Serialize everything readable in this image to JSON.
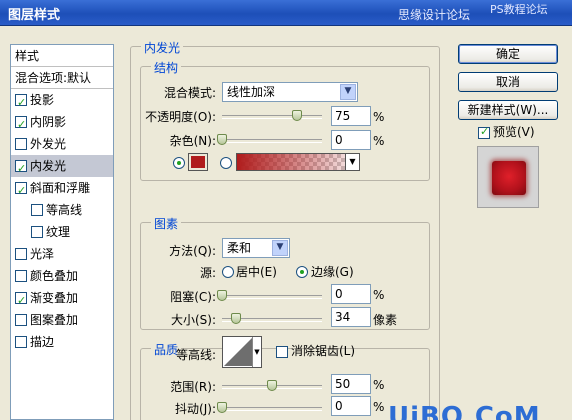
{
  "window": {
    "title": "图层样式",
    "watermark_top": "思缘设计论坛",
    "watermark_top_right": "PS教程论坛"
  },
  "style_list": {
    "header": "样式",
    "blend_options": "混合选项:默认",
    "items": [
      {
        "label": "投影",
        "checked": true,
        "indent": false,
        "selected": false
      },
      {
        "label": "内阴影",
        "checked": true,
        "indent": false,
        "selected": false
      },
      {
        "label": "外发光",
        "checked": false,
        "indent": false,
        "selected": false
      },
      {
        "label": "内发光",
        "checked": true,
        "indent": false,
        "selected": true
      },
      {
        "label": "斜面和浮雕",
        "checked": true,
        "indent": false,
        "selected": false
      },
      {
        "label": "等高线",
        "checked": false,
        "indent": true,
        "selected": false
      },
      {
        "label": "纹理",
        "checked": false,
        "indent": true,
        "selected": false
      },
      {
        "label": "光泽",
        "checked": false,
        "indent": false,
        "selected": false
      },
      {
        "label": "颜色叠加",
        "checked": false,
        "indent": false,
        "selected": false
      },
      {
        "label": "渐变叠加",
        "checked": true,
        "indent": false,
        "selected": false
      },
      {
        "label": "图案叠加",
        "checked": false,
        "indent": false,
        "selected": false
      },
      {
        "label": "描边",
        "checked": false,
        "indent": false,
        "selected": false
      }
    ]
  },
  "inner_glow": {
    "title": "内发光",
    "structure": {
      "title": "结构",
      "blend_mode_label": "混合模式:",
      "blend_mode_value": "线性加深",
      "opacity_label": "不透明度(O):",
      "opacity_value": "75",
      "opacity_fraction": 0.75,
      "noise_label": "杂色(N):",
      "noise_value": "0",
      "noise_fraction": 0.0,
      "percent": "%",
      "glow_color": "#b01c1c"
    },
    "elements": {
      "title": "图素",
      "method_label": "方法(Q):",
      "method_value": "柔和",
      "source_label": "源:",
      "source_center": "居中(E)",
      "source_edge": "边缘(G)",
      "choke_label": "阻塞(C):",
      "choke_value": "0",
      "choke_fraction": 0.0,
      "size_label": "大小(S):",
      "size_value": "34",
      "size_fraction": 0.14,
      "size_unit": "像素",
      "percent": "%"
    },
    "quality": {
      "title": "品质",
      "contour_label": "等高线:",
      "antialias_label": "消除锯齿(L)",
      "range_label": "范围(R):",
      "range_value": "50",
      "range_fraction": 0.5,
      "jitter_label": "抖动(J):",
      "jitter_value": "0",
      "jitter_fraction": 0.0,
      "percent": "%"
    }
  },
  "buttons": {
    "ok": "确定",
    "cancel": "取消",
    "new_style": "新建样式(W)...",
    "preview_label": "预览(V)",
    "preview_checked": true
  },
  "watermark_bottom": "UiBQ.CoM"
}
